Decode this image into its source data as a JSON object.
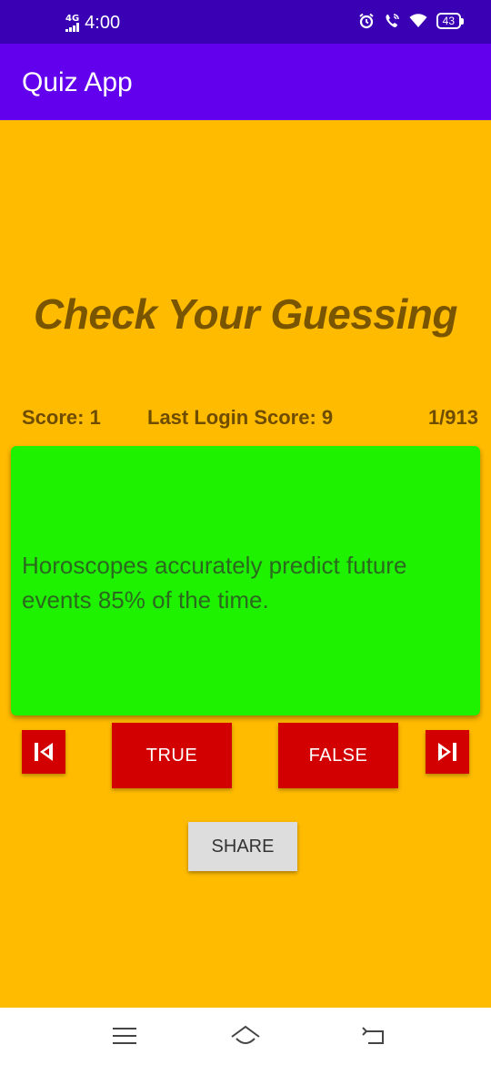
{
  "status_bar": {
    "network": "4G",
    "time": "4:00",
    "battery": "43",
    "icons": [
      "signal-icon",
      "alarm-icon",
      "wifi-calling-icon",
      "wifi-icon",
      "battery-icon"
    ]
  },
  "app_bar": {
    "title": "Quiz App"
  },
  "heading": "Check Your Guessing",
  "stats": {
    "score": "Score: 1",
    "last_login_score": "Last Login Score: 9",
    "progress": "1/913"
  },
  "question": {
    "text": "Horoscopes accurately predict future events 85% of the time."
  },
  "buttons": {
    "true_label": "TRUE",
    "false_label": "FALSE",
    "share_label": "SHARE",
    "prev_icon": "skip-previous-icon",
    "next_icon": "skip-next-icon"
  },
  "nav_bar": {
    "icons": [
      "menu-icon",
      "home-icon",
      "back-icon"
    ]
  },
  "colors": {
    "status_bar": "#3A00B4",
    "app_bar": "#6200EE",
    "background": "#FFBB00",
    "card": "#1EF200",
    "answer_button": "#D20000",
    "share_button": "#DDDDDD"
  }
}
